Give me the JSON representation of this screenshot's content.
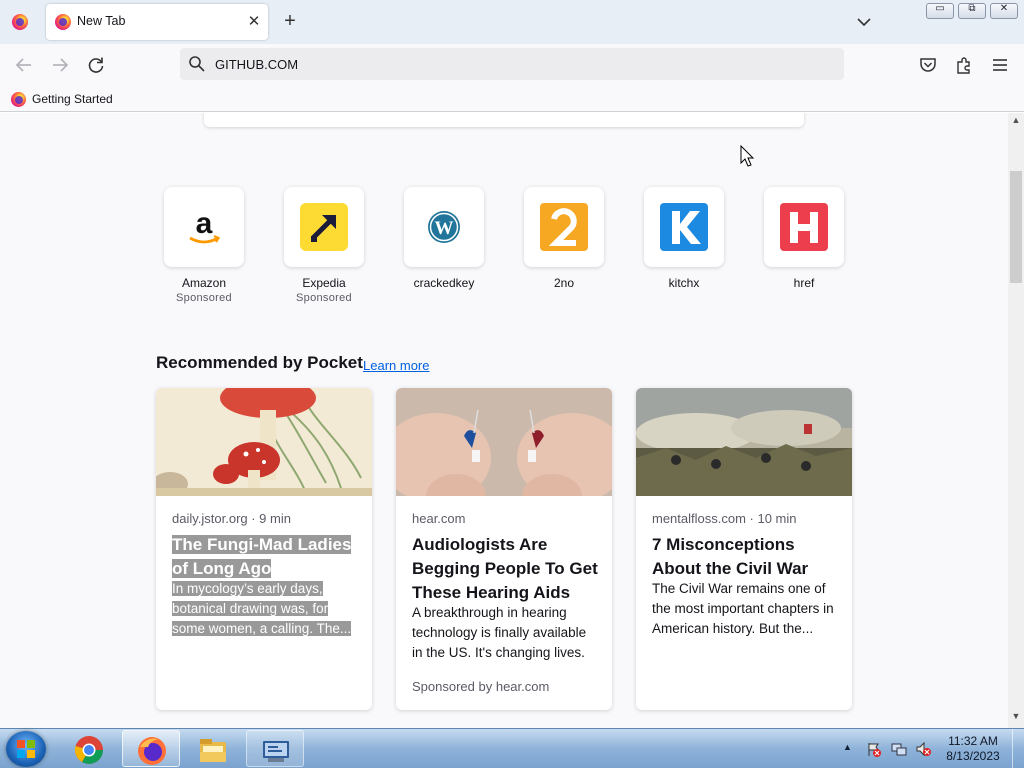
{
  "browser": {
    "tab": {
      "title": "New Tab",
      "close": "✕"
    },
    "new_tab": "+",
    "window": {
      "min": "▭",
      "max": "⧉",
      "close": "✕"
    },
    "url": "GITHUB.COM",
    "bookmark": "Getting Started",
    "icons": [
      "firefox-icon",
      "back-arrow-icon",
      "forward-arrow-icon",
      "reload-icon",
      "search-icon",
      "pocket-icon",
      "extensions-icon",
      "hamburger-menu-icon",
      "chevron-down-icon"
    ]
  },
  "top_sites": [
    {
      "name": "Amazon",
      "sub": "Sponsored",
      "icon": "amazon-icon"
    },
    {
      "name": "Expedia",
      "sub": "Sponsored",
      "icon": "expedia-icon"
    },
    {
      "name": "crackedkey",
      "sub": "",
      "icon": "wordpress-icon"
    },
    {
      "name": "2no",
      "sub": "",
      "icon": "2no-icon"
    },
    {
      "name": "kitchx",
      "sub": "",
      "icon": "kitchx-icon"
    },
    {
      "name": "href",
      "sub": "",
      "icon": "href-icon"
    }
  ],
  "pocket": {
    "heading": "Recommended by Pocket",
    "learn_more": "Learn more",
    "stories": [
      {
        "meta": "daily.jstor.org · 9 min",
        "title_lines": [
          "The Fungi-Mad Ladies",
          "of Long Ago"
        ],
        "excerpt_lines": [
          "In mycology’s early days,",
          "botanical drawing was, for",
          "some women, a calling. The..."
        ],
        "sponsor": ""
      },
      {
        "meta": "hear.com",
        "title": "Audiologists Are Begging People To Get These Hearing Aids",
        "excerpt": "A breakthrough in hearing technology is finally available in the US. It's changing lives.",
        "sponsor": "Sponsored by hear.com"
      },
      {
        "meta": "mentalfloss.com · 10 min",
        "title": "7 Misconceptions About the Civil War",
        "excerpt": "The Civil War remains one of the most important chapters in American history. But the...",
        "sponsor": ""
      }
    ]
  },
  "taskbar": {
    "apps": [
      "chrome-icon",
      "firefox-icon",
      "file-explorer-icon",
      "remote-desktop-icon"
    ],
    "clock": {
      "time": "11:32 AM",
      "date": "8/13/2023"
    }
  },
  "colors": {
    "accent": "#0061e0",
    "taskbar": "#8fb3d9",
    "highlight": "#999999"
  }
}
